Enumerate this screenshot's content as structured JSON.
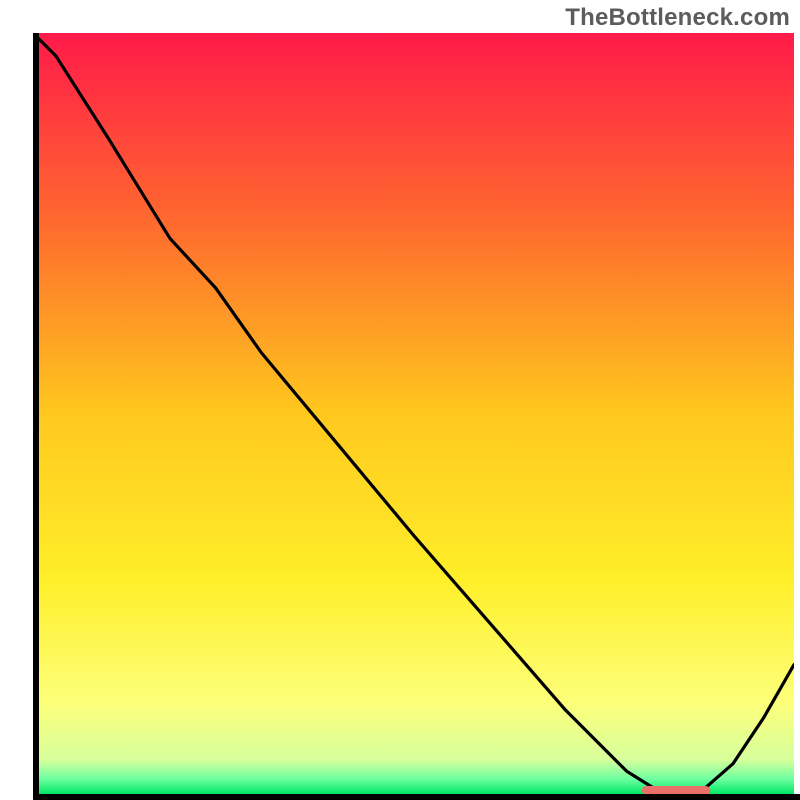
{
  "watermark": "TheBottleneck.com",
  "chart_data": {
    "type": "line",
    "title": "",
    "xlabel": "",
    "ylabel": "",
    "xlim": [
      0,
      100
    ],
    "ylim": [
      0,
      100
    ],
    "annotations": [
      {
        "text": "TheBottleneck.com",
        "position": "top-right"
      }
    ],
    "gradient_stops": [
      {
        "offset": 0.0,
        "color": "#ff1a49"
      },
      {
        "offset": 0.25,
        "color": "#ff6a2e"
      },
      {
        "offset": 0.5,
        "color": "#ffc81e"
      },
      {
        "offset": 0.72,
        "color": "#ffef2a"
      },
      {
        "offset": 0.88,
        "color": "#fdff7a"
      },
      {
        "offset": 0.955,
        "color": "#d7ff9c"
      },
      {
        "offset": 0.98,
        "color": "#6fffa0"
      },
      {
        "offset": 1.0,
        "color": "#00e866"
      }
    ],
    "x": [
      0,
      3,
      10,
      18,
      24,
      30,
      40,
      50,
      60,
      70,
      78,
      82,
      85,
      88,
      92,
      96,
      100
    ],
    "values": [
      100,
      97,
      86,
      73,
      66.5,
      58,
      46,
      34,
      22.5,
      11,
      3,
      0.5,
      0,
      0.5,
      4,
      10,
      17
    ],
    "series": [
      {
        "name": "bottleneck-curve",
        "x": [
          0,
          3,
          10,
          18,
          24,
          30,
          40,
          50,
          60,
          70,
          78,
          82,
          85,
          88,
          92,
          96,
          100
        ],
        "values": [
          100,
          97,
          86,
          73,
          66.5,
          58,
          46,
          34,
          22.5,
          11,
          3,
          0.5,
          0,
          0.5,
          4,
          10,
          17
        ]
      }
    ],
    "optimal_band": {
      "x_start": 80,
      "x_end": 89,
      "y": 0
    }
  },
  "colors": {
    "curve": "#000000",
    "marker": "#e9716a",
    "watermark": "#5c5c5c"
  }
}
